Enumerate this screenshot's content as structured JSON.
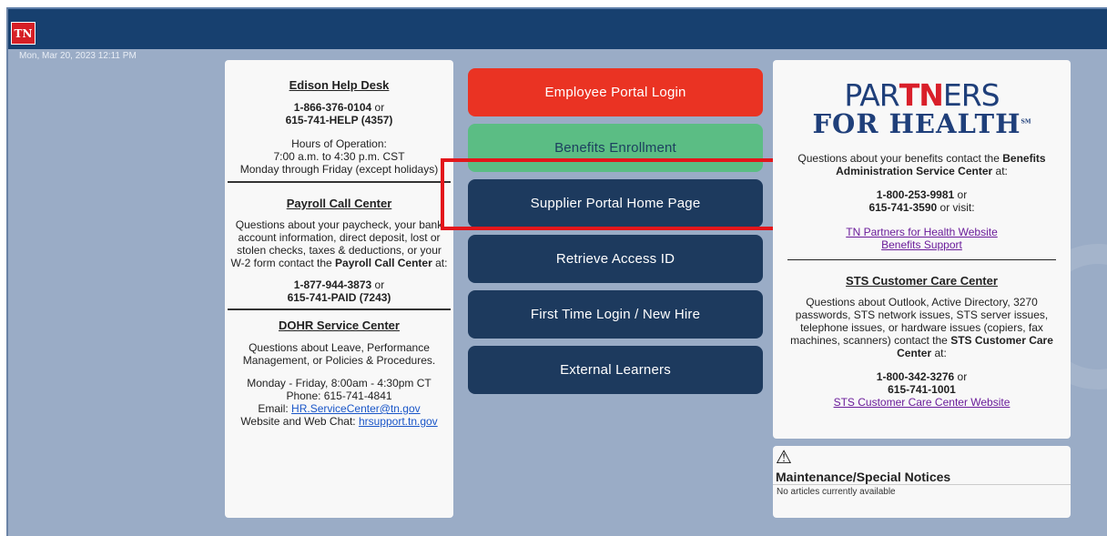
{
  "header": {
    "logo_text": "TN",
    "datetime": "Mon, Mar 20, 2023 12:11 PM"
  },
  "left": {
    "helpdesk": {
      "title": "Edison Help Desk",
      "phone1": "1-866-376-0104",
      "or": " or",
      "phone2": "615-741-HELP (4357)",
      "hours_label": "Hours of Operation:",
      "hours": "7:00 a.m. to 4:30 p.m. CST",
      "days": "Monday through Friday (except holidays)"
    },
    "payroll": {
      "title": "Payroll Call Center",
      "text": "Questions about your paycheck, your bank account information, direct deposit, lost or stolen checks, taxes & deductions, or your W-2 form contact the ",
      "bold": "Payroll Call Center",
      "after": " at:",
      "phone1": "1-877-944-3873",
      "or": " or",
      "phone2": "615-741-PAID (7243)"
    },
    "dohr": {
      "title": "DOHR Service Center",
      "text": "Questions about Leave, Performance Management, or Policies & Procedures.",
      "hours": "Monday - Friday, 8:00am - 4:30pm CT",
      "phone": "Phone: 615-741-4841",
      "email_label": "Email: ",
      "email": "HR.ServiceCenter@tn.gov",
      "web_label": "Website and Web Chat: ",
      "web": "hrsupport.tn.gov"
    }
  },
  "buttons": {
    "employee": "Employee Portal Login",
    "benefits": "Benefits Enrollment",
    "supplier": "Supplier Portal Home Page",
    "access": "Retrieve Access ID",
    "firsttime": "First Time Login / New Hire",
    "external": "External Learners"
  },
  "colors": {
    "red": "#ea3323",
    "green": "#5bbd84",
    "navy": "#1d3a5e",
    "highlight": "#e3161b",
    "header": "#17406f"
  },
  "right": {
    "logo_part1": "PAR",
    "logo_tn": "TN",
    "logo_part2": "ERS",
    "logo_line2": "FOR HEALTH",
    "logo_sm": "SM",
    "benefits_text": "Questions about your benefits contact the ",
    "benefits_bold": "Benefits Administration Service Center",
    "benefits_after": " at:",
    "phone1": "1-800-253-9981",
    "or": " or",
    "phone2": "615-741-3590",
    "or_visit": " or visit:",
    "link1": "TN Partners for Health Website",
    "link2": "Benefits Support",
    "sts_title": "STS Customer Care Center",
    "sts_text": "Questions about Outlook, Active Directory, 3270 passwords, STS network issues, STS server issues, telephone issues, or hardware issues (copiers, fax machines, scanners) contact the ",
    "sts_bold": "STS Customer Care Center",
    "sts_after": " at:",
    "sts_phone1": "1-800-342-3276",
    "sts_phone2": "615-741-1001",
    "sts_link": "STS Customer Care Center Website"
  },
  "notices": {
    "icon": "warning-icon",
    "title": "Maintenance/Special Notices",
    "text": "No articles currently available"
  }
}
